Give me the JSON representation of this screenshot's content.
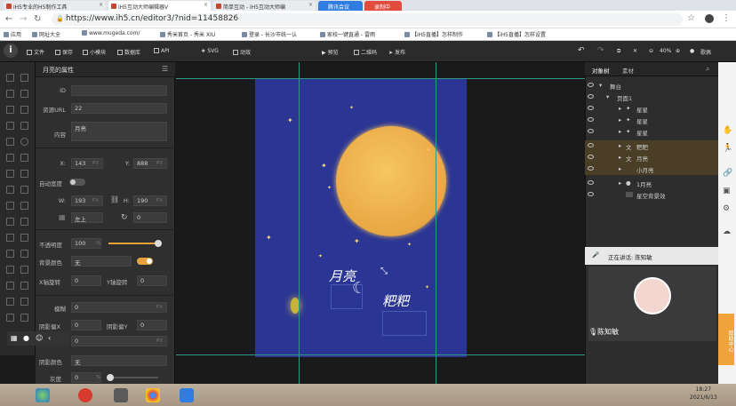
{
  "browser": {
    "tabs": [
      {
        "label": "iH5专业的H5制作工具"
      },
      {
        "label": "iH5互动大师编辑器V"
      },
      {
        "label": "简单互动 - iH5互动大师编"
      },
      {
        "label": "腾讯会议"
      },
      {
        "label": "录制中"
      }
    ],
    "url": "https://www.ih5.cn/editor3/?nid=11458826",
    "bookmarks": [
      "应用",
      "网址大全",
      "www.mugeda.com/",
      "秀米首页 - 秀米 XIU",
      "登录 - 长沙市统一认",
      "家校一键直通 - 雷雨",
      "【iH5直播】怎样制作",
      "【iH5直播】怎样设置"
    ]
  },
  "toolbar": {
    "logo": "i",
    "items": [
      "文件",
      "保存",
      "小模块",
      "数据库",
      "API",
      "SVG",
      "动效",
      "预览",
      "二维码",
      "发布"
    ],
    "zoom": "40%",
    "user": "歌佩"
  },
  "props": {
    "title": "月亮的属性",
    "id_label": "ID",
    "id_value": "",
    "url_label": "资源URL",
    "url_value": "22",
    "content_label": "内容",
    "content_value": "月亮",
    "x_label": "X:",
    "x_value": "143",
    "y_label": "Y:",
    "y_value": "888",
    "unit": "PX",
    "autosize_label": "自动宽度",
    "w_label": "W:",
    "w_value": "193",
    "h_label": "H:",
    "h_value": "190",
    "anchor_value": "左上",
    "rotate_value": "0",
    "opacity_label": "不透明度",
    "opacity_value": "100",
    "opacity_unit": "%",
    "opacity_level": 1.0,
    "bgcolor_label": "背景颜色",
    "bgcolor_value": "无",
    "xrot_label": "X轴旋转",
    "xrot_value": "0",
    "yrot_label": "Y轴旋转",
    "yrot_value": "0",
    "blur_label": "模糊",
    "blur_value": "0",
    "shadowx_label": "阴影偏X",
    "shadowx_value": "0",
    "shadowy_label": "阴影偏Y",
    "shadowy_value": "0",
    "shadow_value": "0",
    "shadowcolor_label": "阴影颜色",
    "shadowcolor_value": "无",
    "gray_label": "灰度",
    "gray_value": "0",
    "gray_unit": "%"
  },
  "canvas": {
    "poem_line1": "月亮",
    "poem_line2": "粑粑",
    "stage_color": "#2b3694",
    "moon_color": "#efb24d"
  },
  "layers_panel": {
    "tabs": [
      "对象树",
      "素材"
    ],
    "items": [
      {
        "name": "舞台",
        "highlight": false
      },
      {
        "name": "页面1",
        "highlight": false
      },
      {
        "name": "星星",
        "highlight": false
      },
      {
        "name": "星星",
        "highlight": false
      },
      {
        "name": "星星",
        "highlight": false
      },
      {
        "name": "粑粑",
        "highlight": true
      },
      {
        "name": "月亮",
        "highlight": true
      },
      {
        "name": "小月亮",
        "highlight": true
      },
      {
        "name": "1月亮",
        "highlight": false
      },
      {
        "name": "星空背景效",
        "highlight": false
      }
    ]
  },
  "meeting": {
    "speaking": "正在讲话: 陈知敏",
    "name": "陈知敏",
    "helper": "帮助中心"
  },
  "taskbar": {
    "time": "18:27",
    "date": "2021/6/13"
  }
}
